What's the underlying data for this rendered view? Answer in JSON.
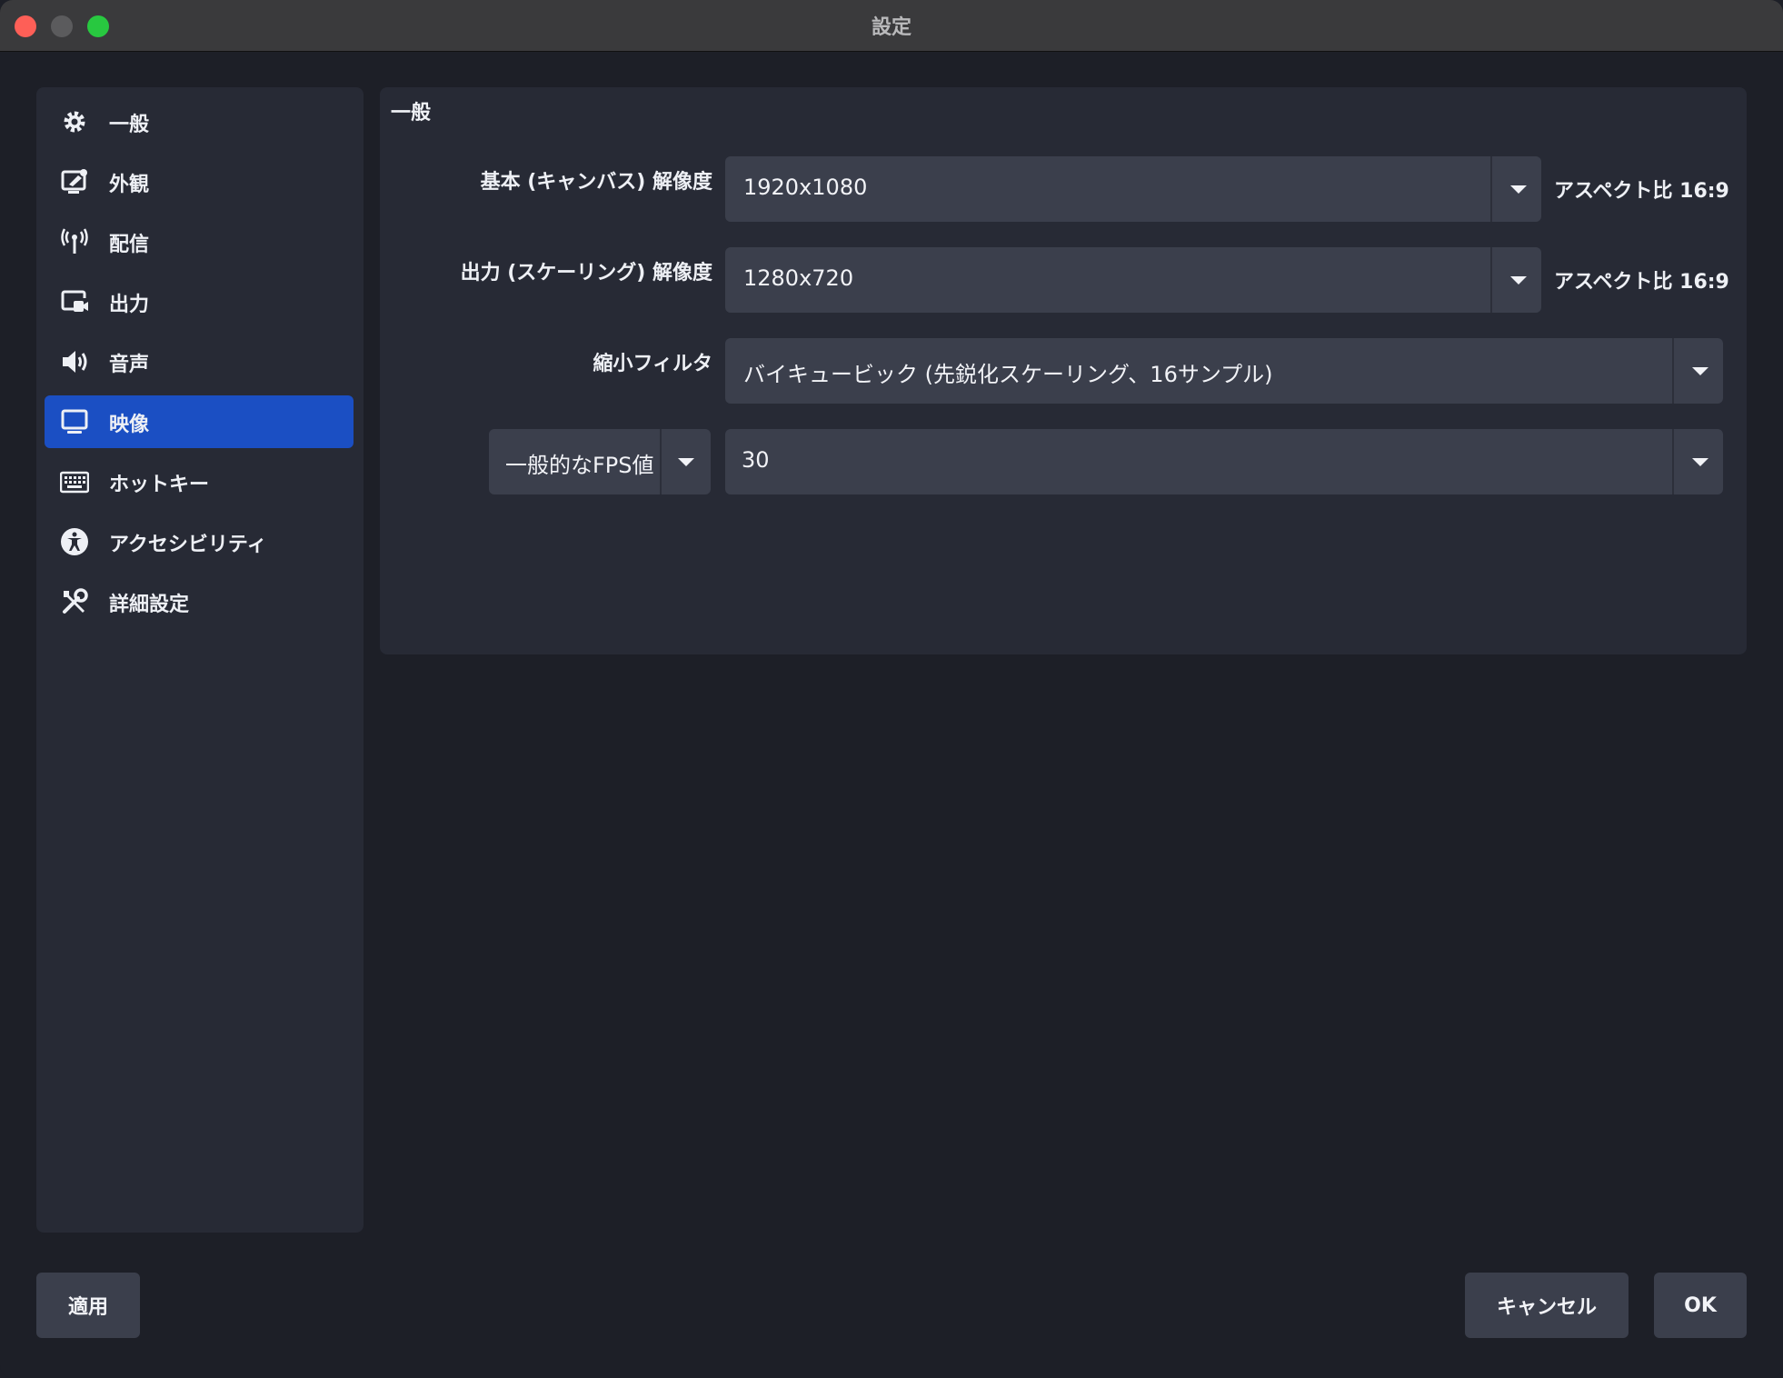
{
  "window": {
    "title": "設定"
  },
  "sidebar": {
    "items": [
      {
        "label": "一般",
        "icon": "gear-icon"
      },
      {
        "label": "外観",
        "icon": "appearance-icon"
      },
      {
        "label": "配信",
        "icon": "antenna-icon"
      },
      {
        "label": "出力",
        "icon": "output-icon"
      },
      {
        "label": "音声",
        "icon": "speaker-icon"
      },
      {
        "label": "映像",
        "icon": "monitor-icon",
        "active": true
      },
      {
        "label": "ホットキー",
        "icon": "keyboard-icon"
      },
      {
        "label": "アクセシビリティ",
        "icon": "accessibility-icon"
      },
      {
        "label": "詳細設定",
        "icon": "tools-icon"
      }
    ]
  },
  "panel": {
    "title": "一般",
    "base_resolution": {
      "label": "基本 (キャンバス) 解像度",
      "value": "1920x1080",
      "aspect_prefix": "アスペクト比",
      "aspect_value": "16:9"
    },
    "output_resolution": {
      "label": "出力 (スケーリング) 解像度",
      "value": "1280x720",
      "aspect_prefix": "アスペクト比",
      "aspect_value": "16:9"
    },
    "downscale_filter": {
      "label": "縮小フィルタ",
      "value": "バイキュービック (先鋭化スケーリング、16サンプル)"
    },
    "fps": {
      "type_value": "一般的なFPS値",
      "value": "30"
    }
  },
  "buttons": {
    "apply": "適用",
    "cancel": "キャンセル",
    "ok": "OK"
  }
}
